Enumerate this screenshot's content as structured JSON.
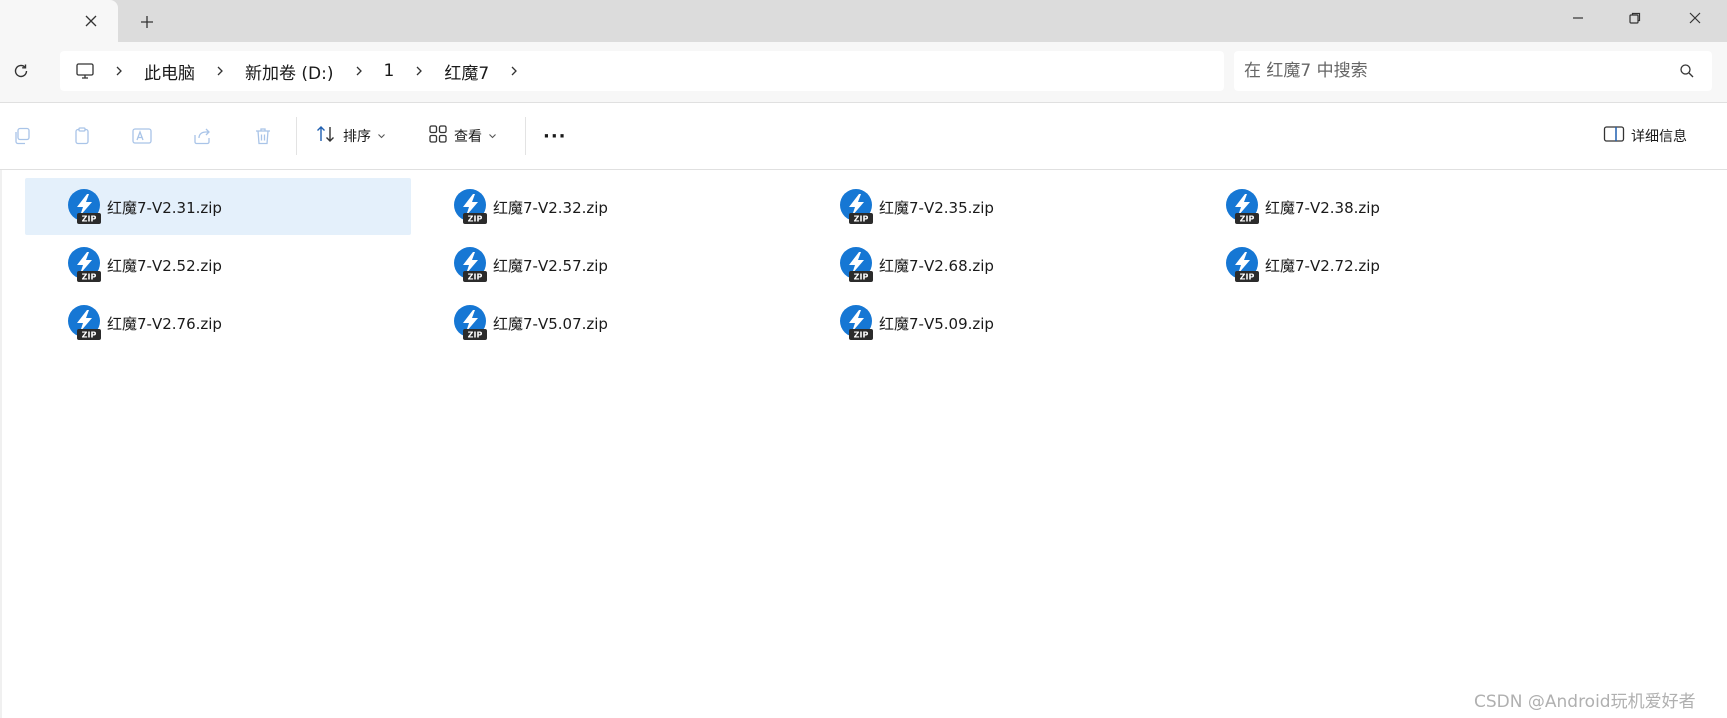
{
  "window": {
    "tab_close_label": "×",
    "new_tab_label": "+"
  },
  "breadcrumb": {
    "items": [
      "此电脑",
      "新加卷 (D:)",
      "1",
      "红魔7"
    ]
  },
  "search": {
    "placeholder": "在 红魔7 中搜索"
  },
  "toolbar": {
    "sort_label": "排序",
    "view_label": "查看",
    "more_label": "···",
    "details_label": "详细信息"
  },
  "icons": {
    "file": "zip-archive-icon",
    "file_color": "#1677d4"
  },
  "files": [
    {
      "name": "红魔7-V2.31.zip",
      "selected": true
    },
    {
      "name": "红魔7-V2.32.zip",
      "selected": false
    },
    {
      "name": "红魔7-V2.35.zip",
      "selected": false
    },
    {
      "name": "红魔7-V2.38.zip",
      "selected": false
    },
    {
      "name": "红魔7-V2.52.zip",
      "selected": false
    },
    {
      "name": "红魔7-V2.57.zip",
      "selected": false
    },
    {
      "name": "红魔7-V2.68.zip",
      "selected": false
    },
    {
      "name": "红魔7-V2.72.zip",
      "selected": false
    },
    {
      "name": "红魔7-V2.76.zip",
      "selected": false
    },
    {
      "name": "红魔7-V5.07.zip",
      "selected": false
    },
    {
      "name": "红魔7-V5.09.zip",
      "selected": false
    }
  ],
  "watermark": "CSDN @Android玩机爱好者"
}
